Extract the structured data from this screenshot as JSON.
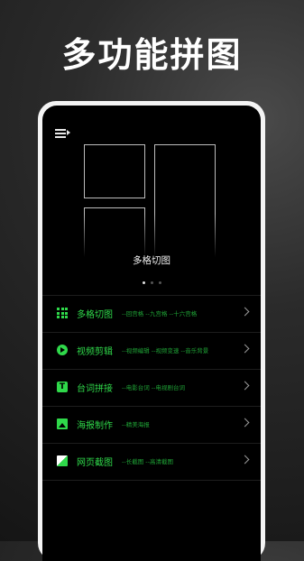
{
  "headline": "多功能拼图",
  "banner": {
    "label": "多格切图",
    "page_index": 1,
    "page_count": 3
  },
  "menu": [
    {
      "name": "多格切图",
      "sub": "--回宫格  --九宫格  --十六宫格",
      "icon": "grid-icon"
    },
    {
      "name": "视频剪辑",
      "sub": "--视频编辑  --视频变速  --音乐背景",
      "icon": "video-icon"
    },
    {
      "name": "台词拼接",
      "sub": "--电影台词  --电视剧台词",
      "icon": "text-icon"
    },
    {
      "name": "海报制作",
      "sub": "--精美海报",
      "icon": "poster-icon"
    },
    {
      "name": "网页截图",
      "sub": "--长截图  --高清截图",
      "icon": "webpage-icon"
    }
  ],
  "colors": {
    "accent": "#2fd84a",
    "screen": "#000000",
    "frame": "#f4f4f4"
  }
}
